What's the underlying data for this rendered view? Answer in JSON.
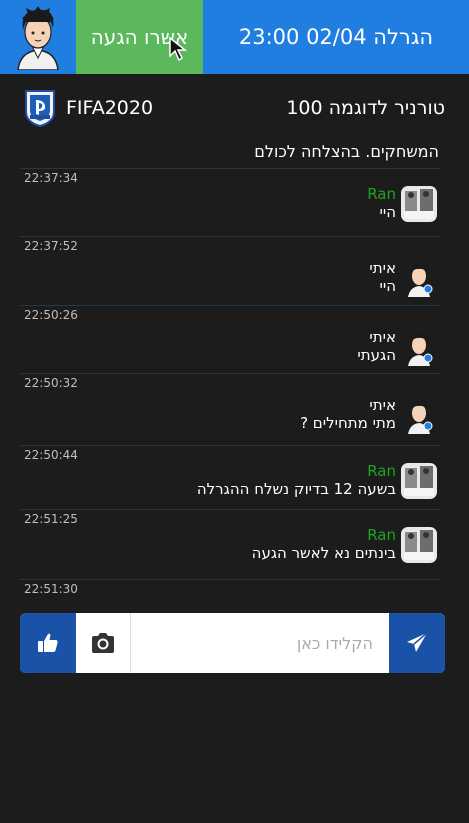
{
  "topbar": {
    "confirm_label": "אשרו הגעה",
    "draw_label": "הגרלה 02/04 23:00"
  },
  "tournament": {
    "game": "FIFA2020",
    "title": "טורניר לדוגמה 100"
  },
  "welcome_text": "המשחקים. בהצלחה לכולם",
  "messages": [
    {
      "time": "22:37:34",
      "author": "Ran",
      "text": "היי",
      "role": "admin"
    },
    {
      "time": "22:37:52",
      "author": "איתי",
      "text": "היי",
      "role": "user"
    },
    {
      "time": "22:50:26",
      "author": "איתי",
      "text": "הגעתי",
      "role": "user"
    },
    {
      "time": "22:50:32",
      "author": "איתי",
      "text": "מתי מתחילים ?",
      "role": "user"
    },
    {
      "time": "22:50:44",
      "author": "Ran",
      "text": "בשעה 12 בדיוק נשלח ההגרלה",
      "role": "admin"
    },
    {
      "time": "22:51:25",
      "author": "Ran",
      "text": "בינתים נא לאשר הגעה",
      "role": "admin"
    },
    {
      "time": "22:51:30"
    }
  ],
  "input": {
    "placeholder": "הקלידו כאן"
  },
  "icons": {
    "like": "thumbs-up-icon",
    "camera": "camera-icon",
    "send": "send-icon"
  },
  "colors": {
    "topbar_blue": "#1f7ee0",
    "confirm_green": "#5cb85c",
    "admin_name": "#1fa51f",
    "button_blue": "#1a52a8"
  }
}
